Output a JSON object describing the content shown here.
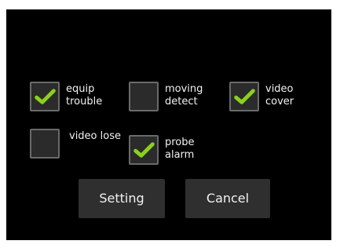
{
  "options": [
    {
      "line1": "equip",
      "line2": "trouble",
      "checked": true
    },
    {
      "line1": "moving",
      "line2": "detect",
      "checked": false
    },
    {
      "line1": "video",
      "line2": "cover",
      "checked": true
    },
    {
      "line1": "video lose",
      "line2": "",
      "checked": false
    },
    {
      "line1": "probe",
      "line2": "alarm",
      "checked": true
    }
  ],
  "buttons": {
    "setting": "Setting",
    "cancel": "Cancel"
  },
  "colors": {
    "check_mark": "#8bd11c",
    "background": "#000000"
  }
}
